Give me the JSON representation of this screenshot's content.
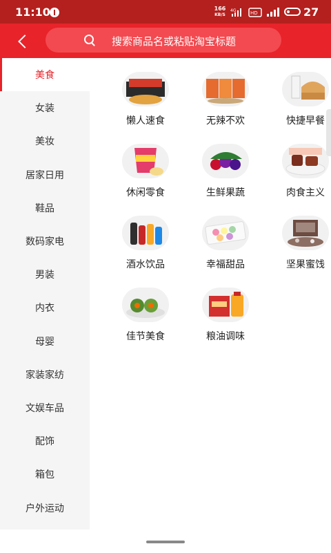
{
  "status_bar": {
    "time": "11:10",
    "net_speed": "166",
    "net_speed_unit": "KB/S",
    "network_type": "4G",
    "network_label": "HD",
    "battery": "27"
  },
  "search": {
    "placeholder": "搜索商品名或粘贴淘宝标题"
  },
  "sidebar": {
    "items": [
      {
        "label": "美食",
        "active": true
      },
      {
        "label": "女装"
      },
      {
        "label": "美妆"
      },
      {
        "label": "居家日用"
      },
      {
        "label": "鞋品"
      },
      {
        "label": "数码家电"
      },
      {
        "label": "男装"
      },
      {
        "label": "内衣"
      },
      {
        "label": "母婴"
      },
      {
        "label": "家装家纺"
      },
      {
        "label": "文娱车品"
      },
      {
        "label": "配饰"
      },
      {
        "label": "箱包"
      },
      {
        "label": "户外运动"
      }
    ]
  },
  "categories": [
    {
      "label": "懒人速食",
      "icon": "instant-noodles-icon"
    },
    {
      "label": "无辣不欢",
      "icon": "spicy-snacks-icon"
    },
    {
      "label": "快捷早餐",
      "icon": "bread-milk-icon"
    },
    {
      "label": "休闲零食",
      "icon": "chips-bag-icon"
    },
    {
      "label": "生鲜果蔬",
      "icon": "fresh-fruit-icon"
    },
    {
      "label": "肉食主义",
      "icon": "meat-platter-icon"
    },
    {
      "label": "酒水饮品",
      "icon": "drink-bottles-icon"
    },
    {
      "label": "幸福甜品",
      "icon": "macaron-box-icon"
    },
    {
      "label": "坚果蜜饯",
      "icon": "nuts-gift-box-icon"
    },
    {
      "label": "佳节美食",
      "icon": "rice-cake-icon"
    },
    {
      "label": "粮油调味",
      "icon": "rice-oil-icon"
    }
  ]
}
